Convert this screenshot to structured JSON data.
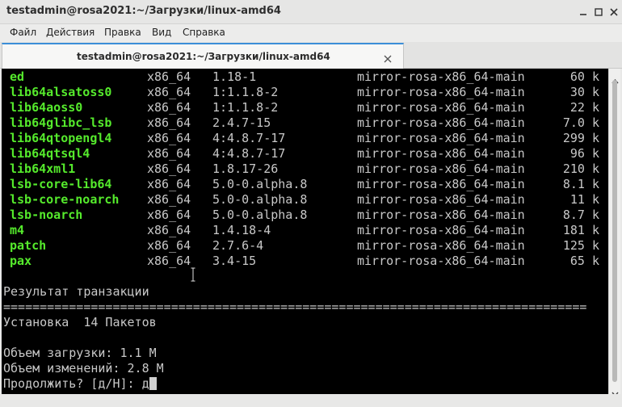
{
  "window": {
    "title": "testadmin@rosa2021:~/Загрузки/linux-amd64",
    "controls": [
      "minimize-icon",
      "maximize-icon",
      "close-icon"
    ]
  },
  "menu": {
    "items": [
      "Файл",
      "Действия",
      "Правка",
      "Вид",
      "Справка"
    ]
  },
  "tab": {
    "label": "testadmin@rosa2021:~/Загрузки/linux-amd64",
    "close_icon": "close-icon"
  },
  "terminal": {
    "packages": [
      {
        "name": "ed",
        "arch": "x86_64",
        "version": "1.18-1",
        "repo": "mirror-rosa-x86_64-main",
        "size": "60 k"
      },
      {
        "name": "lib64alsatoss0",
        "arch": "x86_64",
        "version": "1:1.1.8-2",
        "repo": "mirror-rosa-x86_64-main",
        "size": "30 k"
      },
      {
        "name": "lib64aoss0",
        "arch": "x86_64",
        "version": "1:1.1.8-2",
        "repo": "mirror-rosa-x86_64-main",
        "size": "22 k"
      },
      {
        "name": "lib64glibc_lsb",
        "arch": "x86_64",
        "version": "2.4.7-15",
        "repo": "mirror-rosa-x86_64-main",
        "size": "7.0 k"
      },
      {
        "name": "lib64qtopengl4",
        "arch": "x86_64",
        "version": "4:4.8.7-17",
        "repo": "mirror-rosa-x86_64-main",
        "size": "299 k"
      },
      {
        "name": "lib64qtsql4",
        "arch": "x86_64",
        "version": "4:4.8.7-17",
        "repo": "mirror-rosa-x86_64-main",
        "size": "96 k"
      },
      {
        "name": "lib64xml1",
        "arch": "x86_64",
        "version": "1.8.17-26",
        "repo": "mirror-rosa-x86_64-main",
        "size": "210 k"
      },
      {
        "name": "lsb-core-lib64",
        "arch": "x86_64",
        "version": "5.0-0.alpha.8",
        "repo": "mirror-rosa-x86_64-main",
        "size": "8.1 k"
      },
      {
        "name": "lsb-core-noarch",
        "arch": "x86_64",
        "version": "5.0-0.alpha.8",
        "repo": "mirror-rosa-x86_64-main",
        "size": "11 k"
      },
      {
        "name": "lsb-noarch",
        "arch": "x86_64",
        "version": "5.0-0.alpha.8",
        "repo": "mirror-rosa-x86_64-main",
        "size": "8.7 k"
      },
      {
        "name": "m4",
        "arch": "x86_64",
        "version": "1.4.18-4",
        "repo": "mirror-rosa-x86_64-main",
        "size": "181 k"
      },
      {
        "name": "patch",
        "arch": "x86_64",
        "version": "2.7.6-4",
        "repo": "mirror-rosa-x86_64-main",
        "size": "125 k"
      },
      {
        "name": "pax",
        "arch": "x86_64",
        "version": "3.4-15",
        "repo": "mirror-rosa-x86_64-main",
        "size": "65 k"
      }
    ],
    "summary_heading": "Результат транзакции",
    "separator": "================================================================================",
    "install_line": "Установка  14 Пакетов",
    "download_size": "Объем загрузки: 1.1 M",
    "installed_size": "Объем изменений: 2.8 M",
    "prompt": "Продолжить? [д/Н]: ",
    "input_value": "д"
  }
}
